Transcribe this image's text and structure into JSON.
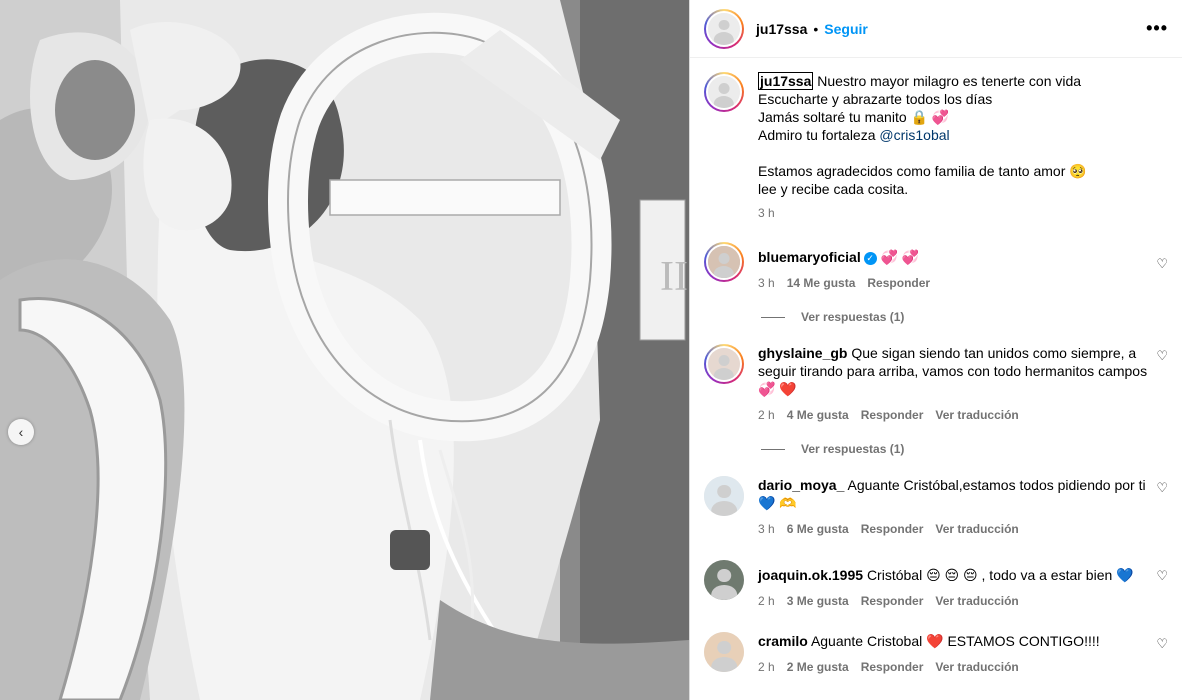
{
  "post": {
    "author": "ju17ssa",
    "follow_label": "Seguir",
    "more_label": "•••",
    "carousel_prev": "‹"
  },
  "caption": {
    "username": "ju17ssa",
    "line1": "Nuestro mayor milagro es tenerte con vida",
    "line2": "Escucharte y abrazarte todos los días",
    "line3": "Jamás soltaré tu manito 🔒 💞",
    "line4_prefix": "Admiro tu fortaleza",
    "line4_mention": "@cris1obal",
    "line5": "Estamos agradecidos como familia de tanto amor 🥺",
    "line6": "lee y recibe cada cosita.",
    "time": "3 h"
  },
  "comments": [
    {
      "username": "bluemaryoficial",
      "verified": true,
      "text": "💞 💞",
      "time": "3 h",
      "likes": "14 Me gusta",
      "reply": "Responder",
      "translate": "",
      "replies": "Ver respuestas (1)"
    },
    {
      "username": "ghyslaine_gb",
      "text": "Que sigan siendo tan unidos como siempre, a seguir tirando para arriba, vamos con todo hermanitos campos",
      "text_emoji": "💞 ❤️",
      "time": "2 h",
      "likes": "4 Me gusta",
      "reply": "Responder",
      "translate": "Ver traducción",
      "replies": "Ver respuestas (1)"
    },
    {
      "username": "dario_moya_",
      "text": "Aguante Cristóbal,estamos todos pidiendo por ti",
      "text_emoji": "💙 🫶",
      "time": "3 h",
      "likes": "6 Me gusta",
      "reply": "Responder",
      "translate": "Ver traducción"
    },
    {
      "username": "joaquin.ok.1995",
      "text": "Cristóbal 😔 😔 😔 , todo va a estar bien 💙",
      "time": "2 h",
      "likes": "3 Me gusta",
      "reply": "Responder",
      "translate": "Ver traducción"
    },
    {
      "username": "cramilo",
      "text": "Aguante Cristobal ❤️ ESTAMOS CONTIGO!!!!",
      "time": "2 h",
      "likes": "2 Me gusta",
      "reply": "Responder",
      "translate": "Ver traducción"
    }
  ],
  "icons": {
    "heart": "♡",
    "verified": "✓"
  }
}
